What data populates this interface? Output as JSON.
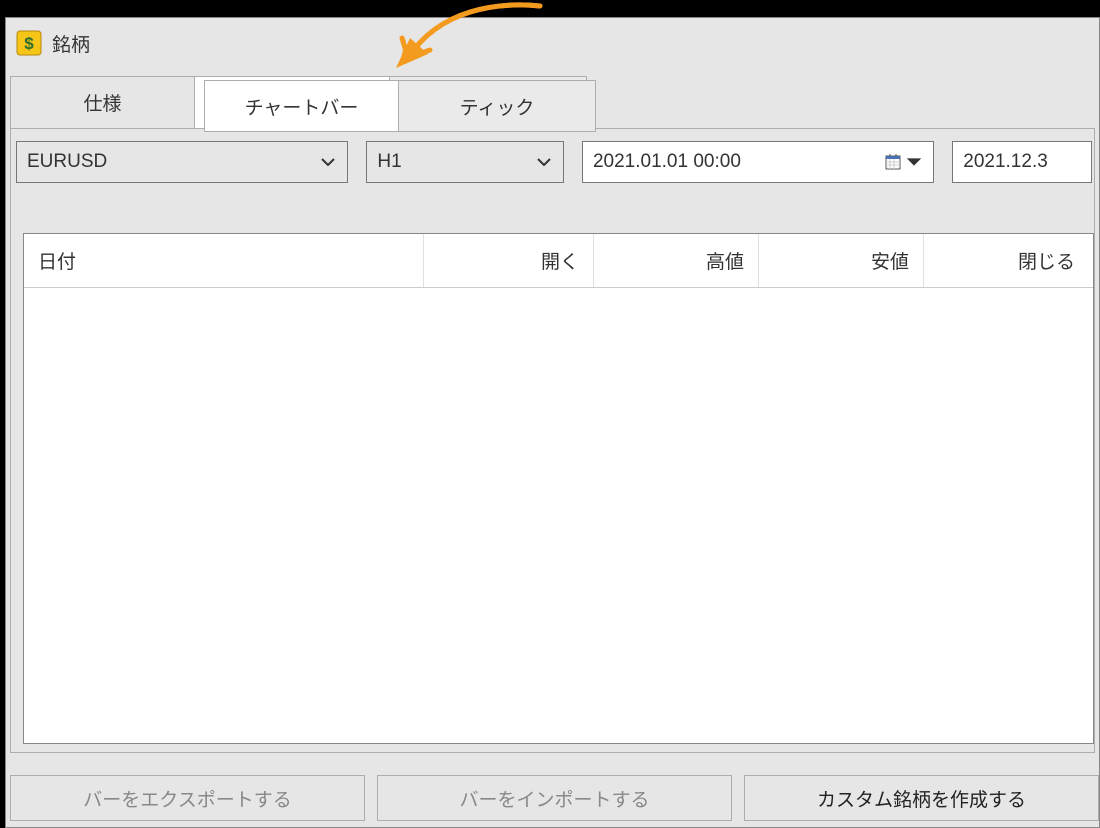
{
  "window": {
    "title": "銘柄"
  },
  "tabs": {
    "spec": "仕様",
    "chart": "チャートバー",
    "tick": "ティック"
  },
  "filters": {
    "symbol": "EURUSD",
    "period": "H1",
    "date_from": "2021.01.01 00:00",
    "date_to": "2021.12.3"
  },
  "table": {
    "columns": {
      "date": "日付",
      "open": "開く",
      "high": "高値",
      "low": "安値",
      "close": "閉じる"
    }
  },
  "buttons": {
    "export": "バーをエクスポートする",
    "import": "バーをインポートする",
    "create": "カスタム銘柄を作成する"
  }
}
